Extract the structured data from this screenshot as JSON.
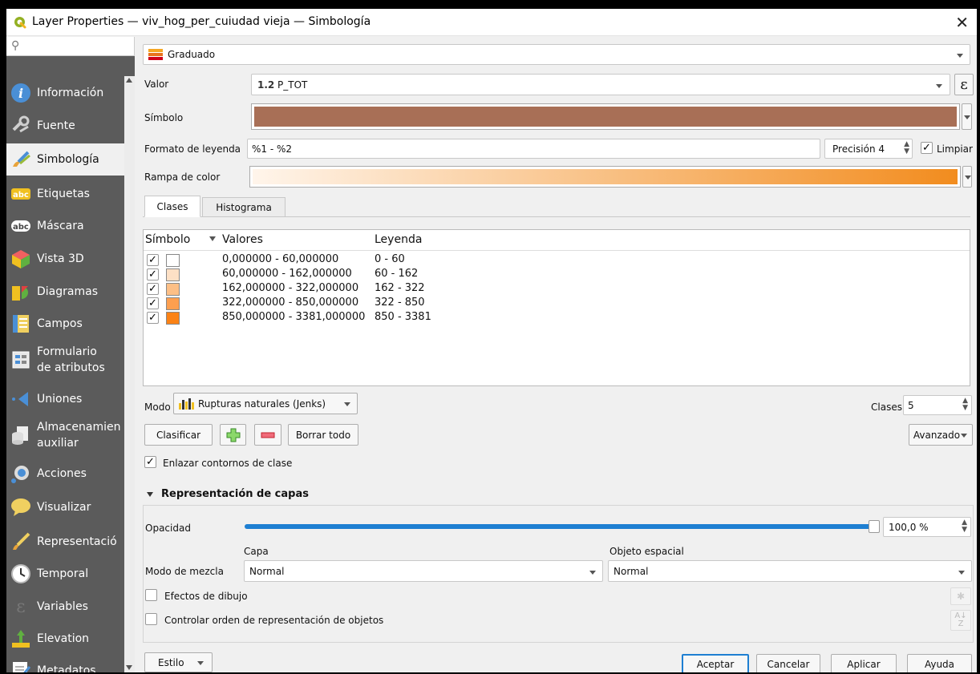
{
  "window": {
    "title": "Layer Properties — viv_hog_per_cuiudad vieja — Simbología",
    "close_glyph": "✕"
  },
  "sidebar": {
    "search_placeholder": "",
    "items": [
      {
        "label": "Información",
        "icon": "info-icon"
      },
      {
        "label": "Fuente",
        "icon": "source-icon"
      },
      {
        "label": "Simbología",
        "icon": "paintbrush-icon",
        "selected": true
      },
      {
        "label": "Etiquetas",
        "icon": "labels-abc-icon"
      },
      {
        "label": "Máscara",
        "icon": "mask-abc-icon"
      },
      {
        "label": "Vista 3D",
        "icon": "cube-3d-icon"
      },
      {
        "label": "Diagramas",
        "icon": "diagram-icon"
      },
      {
        "label": "Campos",
        "icon": "fields-table-icon"
      },
      {
        "label": "Formulario de atributos",
        "label_line1": "Formulario",
        "label_line2": "de atributos",
        "icon": "form-icon"
      },
      {
        "label": "Uniones",
        "icon": "joins-icon"
      },
      {
        "label": "Almacenamiento auxiliar",
        "label_line1": "Almacenamien",
        "label_line2": "auxiliar",
        "icon": "database-icon"
      },
      {
        "label": "Acciones",
        "icon": "actions-gear-icon"
      },
      {
        "label": "Visualizar",
        "icon": "speech-bubble-icon"
      },
      {
        "label": "Representació",
        "icon": "rendering-brush-icon"
      },
      {
        "label": "Temporal",
        "icon": "clock-icon"
      },
      {
        "label": "Variables",
        "icon": "epsilon-icon"
      },
      {
        "label": "Elevation",
        "icon": "elevation-icon"
      },
      {
        "label": "Metadatos",
        "icon": "metadata-icon"
      }
    ]
  },
  "renderer": {
    "selected": "Graduado"
  },
  "valor": {
    "label": "Valor",
    "prefix": "1.2",
    "value": "P_TOT",
    "expr_glyph": "ε"
  },
  "simbolo": {
    "label": "Símbolo",
    "color": "#a86f56"
  },
  "formato": {
    "label": "Formato de leyenda",
    "value": "%1 - %2",
    "precision_label": "Precisión 4",
    "limpiar_label": "Limpiar",
    "limpiar_checked": true
  },
  "rampa": {
    "label": "Rampa de color",
    "start_color": "#fff5eb",
    "end_color": "#f28c1e"
  },
  "tabs": [
    {
      "label": "Clases",
      "active": true
    },
    {
      "label": "Histograma",
      "active": false
    }
  ],
  "classes_table": {
    "headers": {
      "symbol": "Símbolo",
      "values": "Valores",
      "legend": "Leyenda"
    },
    "rows": [
      {
        "checked": true,
        "color": "#ffffff",
        "values": "0,000000 - 60,000000",
        "legend": "0 - 60"
      },
      {
        "checked": true,
        "color": "#fde0c5",
        "values": "60,000000 - 162,000000",
        "legend": "60 - 162"
      },
      {
        "checked": true,
        "color": "#fdbf86",
        "values": "162,000000 - 322,000000",
        "legend": "162 - 322"
      },
      {
        "checked": true,
        "color": "#fd9f4f",
        "values": "322,000000 - 850,000000",
        "legend": "322 - 850"
      },
      {
        "checked": true,
        "color": "#fb8215",
        "values": "850,000000 - 3381,000000",
        "legend": "850 - 3381"
      }
    ]
  },
  "modo": {
    "label": "Modo",
    "value": "Rupturas naturales (Jenks)",
    "clases_label": "Clases",
    "clases_value": "5"
  },
  "buttons": {
    "clasificar": "Clasificar",
    "borrar_todo": "Borrar todo",
    "avanzado": "Avanzado"
  },
  "enlazar": {
    "label": "Enlazar contornos de clase",
    "checked": true
  },
  "layer_rendering": {
    "section_title": "Representación de capas",
    "opacidad_label": "Opacidad",
    "opacidad_value": "100,0 %",
    "opacidad_fraction": 1.0,
    "modo_mezcla_label": "Modo de mezcla",
    "capa_label": "Capa",
    "capa_value": "Normal",
    "objeto_label": "Objeto espacial",
    "objeto_value": "Normal",
    "efectos_label": "Efectos de dibujo",
    "orden_label": "Controlar orden de representación de objetos"
  },
  "footer": {
    "estilo": "Estilo",
    "aceptar": "Aceptar",
    "cancelar": "Cancelar",
    "aplicar": "Aplicar",
    "ayuda": "Ayuda"
  },
  "colors": {
    "accent": "#1e7fd2",
    "sidebar_bg": "#5b5b5b"
  }
}
